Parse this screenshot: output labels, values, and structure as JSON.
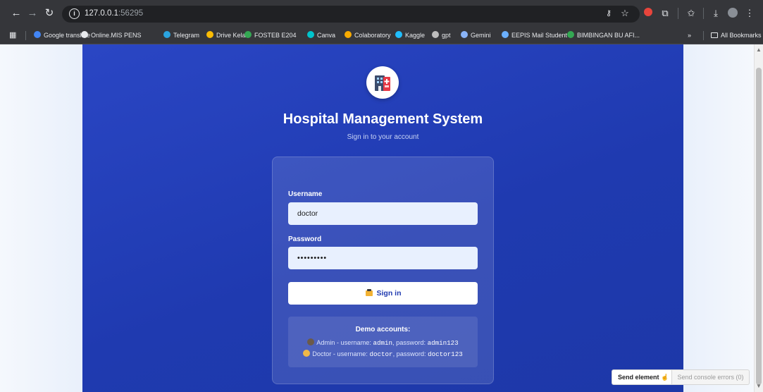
{
  "browser": {
    "url_host": "127.0.0.1",
    "url_port": ":56295",
    "bookmarks": [
      {
        "label": "Google translate",
        "color": "#4285f4"
      },
      {
        "label": "Online.MIS PENS",
        "color": "#e8eaed"
      },
      {
        "label": "Telegram",
        "color": "#2aa3df"
      },
      {
        "label": "Drive Kelas",
        "color": "#fbbc04"
      },
      {
        "label": "FOSTEB E204",
        "color": "#34a853"
      },
      {
        "label": "Canva",
        "color": "#00c4cc"
      },
      {
        "label": "Colaboratory",
        "color": "#f9ab00"
      },
      {
        "label": "Kaggle",
        "color": "#20beff"
      },
      {
        "label": "gpt",
        "color": "#bdbdbd"
      },
      {
        "label": "Gemini",
        "color": "#8ab4f8"
      },
      {
        "label": "EEPIS Mail Student",
        "color": "#6bb0ff"
      },
      {
        "label": "BIMBINGAN BU AFI...",
        "color": "#34a853"
      }
    ],
    "more_label": "»",
    "all_bookmarks": "All Bookmarks"
  },
  "app": {
    "title": "Hospital Management System",
    "subtitle": "Sign in to your account",
    "username_label": "Username",
    "username_value": "doctor",
    "password_label": "Password",
    "password_value": "•••••••••",
    "signin_label": "Sign in",
    "demo": {
      "title": "Demo accounts:",
      "admin_prefix": "Admin - username: ",
      "admin_user": "admin",
      "admin_mid": ", password: ",
      "admin_pass": "admin123",
      "doctor_prefix": "Doctor - username: ",
      "doctor_user": "doctor",
      "doctor_mid": ", password: ",
      "doctor_pass": "doctor123"
    }
  },
  "overlay": {
    "send_element": "Send element",
    "send_errors": "Send console errors (0)"
  },
  "colors": {
    "hero": "#2a46c4",
    "accent": "#1f3ab0"
  }
}
